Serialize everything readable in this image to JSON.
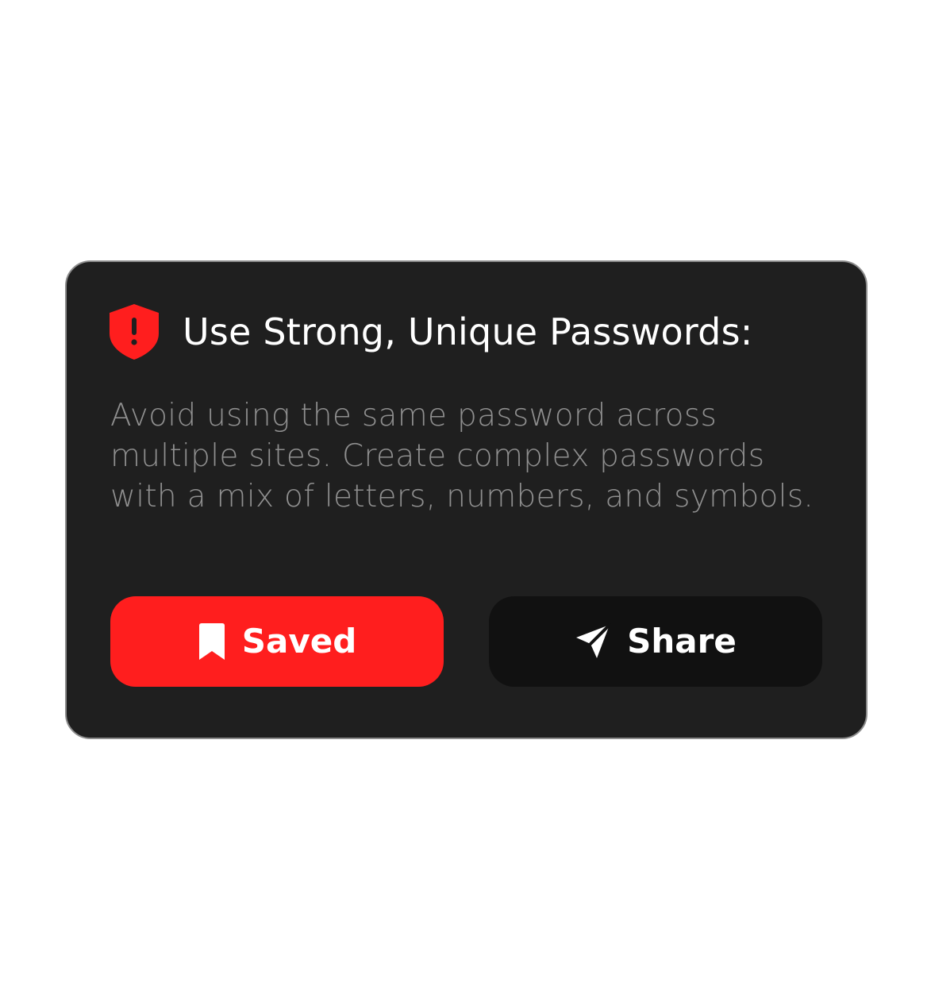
{
  "card": {
    "title": "Use Strong, Unique Passwords:",
    "description": "Avoid using the same password across multiple sites. Create complex passwords with a mix of letters, numbers, and symbols.",
    "icon": "shield-alert-icon"
  },
  "actions": {
    "saved_label": "Saved",
    "saved_icon": "bookmark-icon",
    "share_label": "Share",
    "share_icon": "send-icon"
  },
  "colors": {
    "accent": "#ff1e1e",
    "card_background": "#1f1f1f",
    "share_button_background": "#111111",
    "description_text": "#8f8f8f"
  }
}
